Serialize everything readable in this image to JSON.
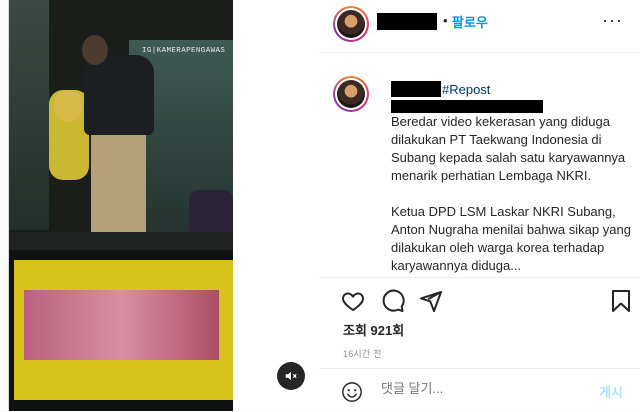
{
  "media": {
    "watermark": "IG|KAMERAPENGAWAS",
    "mute_icon": "speaker-muted-icon"
  },
  "header": {
    "dot": "•",
    "follow_label": "팔로우",
    "more_icon": "ellipsis-icon",
    "more_label": "···"
  },
  "caption": {
    "repost_tag": "#Repost",
    "text": "Beredar video kekerasan yang diduga dilakukan PT Taekwang Indonesia di Subang kepada salah satu karyawannya menarik perhatian Lembaga NKRI.\n\nKetua DPD LSM Laskar NKRI Subang, Anton Nugraha menilai bahwa sikap yang dilakukan oleh warga korea terhadap karyawannya diduga..."
  },
  "actions": {
    "like_icon": "heart-icon",
    "comment_icon": "comment-icon",
    "share_icon": "paper-plane-icon",
    "save_icon": "bookmark-icon"
  },
  "stats": {
    "views_label": "조회",
    "views_count": "921회",
    "time_ago": "16시간 전"
  },
  "comment": {
    "emoji_icon": "smiley-icon",
    "placeholder": "댓글 달기...",
    "post_label": "게시"
  },
  "colors": {
    "link": "#0095f6",
    "hashtag": "#00376b",
    "muted": "#8e8e8e",
    "post_disabled": "#b2dffc"
  }
}
